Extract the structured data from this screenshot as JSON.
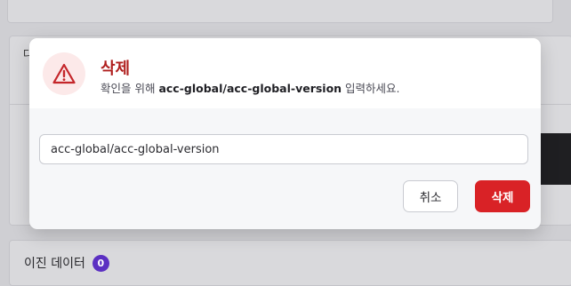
{
  "background": {
    "section_letter": "다",
    "migration_label": "이진 데이터",
    "migration_count": "0"
  },
  "dialog": {
    "title": "삭제",
    "desc_prefix": "확인을 위해 ",
    "desc_target": "acc-global/acc-global-version",
    "desc_suffix": " 입력하세요.",
    "input_value": "acc-global/acc-global-version",
    "cancel_label": "취소",
    "delete_label": "삭제"
  },
  "colors": {
    "danger": "#d92226",
    "title_red": "#b0201f",
    "badge_purple": "#5b2fc2"
  },
  "icons": {
    "warning": "warning-triangle-icon"
  }
}
